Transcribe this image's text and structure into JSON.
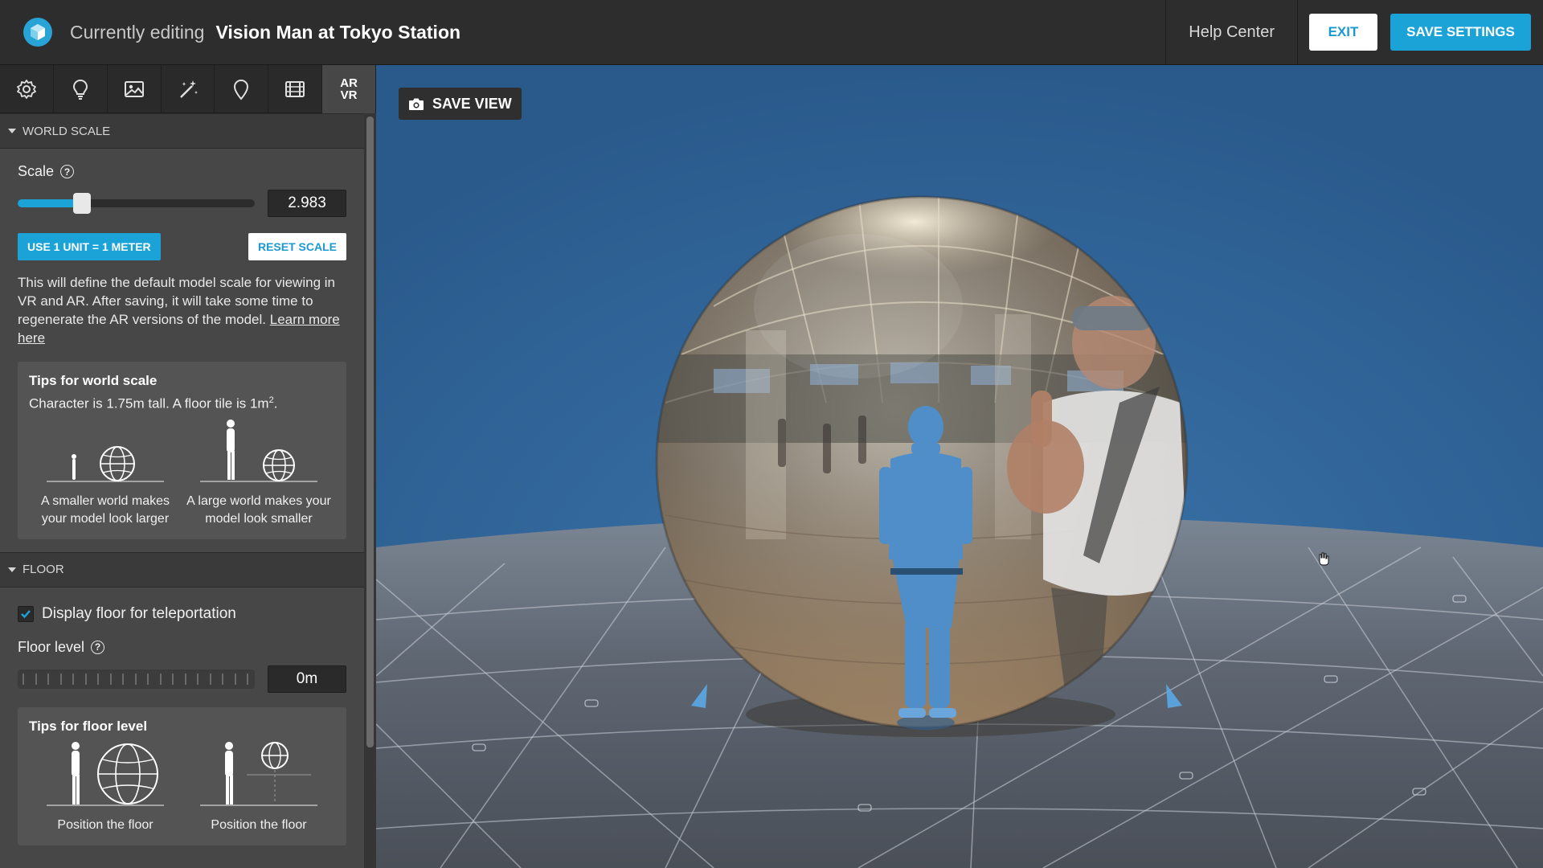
{
  "header": {
    "prefix": "Currently editing",
    "title": "Vision Man at Tokyo Station",
    "help_label": "Help Center",
    "exit_label": "EXIT",
    "save_label": "SAVE SETTINGS"
  },
  "toolbar": {
    "tools": [
      "settings-icon",
      "lightbulb-icon",
      "image-icon",
      "magic-wand-icon",
      "map-pin-icon",
      "film-icon",
      "ar-vr-icon"
    ],
    "ar_vr_label_top": "AR",
    "ar_vr_label_bottom": "VR",
    "active": "ar-vr"
  },
  "world_scale": {
    "section_title": "WORLD SCALE",
    "scale_label": "Scale",
    "scale_value": "2.983",
    "slider_fraction": 0.27,
    "unit_button": "USE 1 UNIT = 1 METER",
    "reset_button": "RESET SCALE",
    "description": "This will define the default model scale for viewing in VR and AR. After saving, it will take some time to regenerate the AR versions of the model.",
    "learn_more": "Learn more here",
    "tips_title": "Tips for world scale",
    "tips_sub_prefix": "Character is 1.75m tall. A floor tile is 1m",
    "tips_sub_sup": "2",
    "tips_sub_suffix": ".",
    "tip_small": "A smaller world makes your model look larger",
    "tip_large": "A large world makes your model look smaller"
  },
  "floor": {
    "section_title": "FLOOR",
    "display_label": "Display floor for teleportation",
    "display_checked": true,
    "level_label": "Floor level",
    "level_value": "0m",
    "tips_title": "Tips for floor level",
    "tip_left": "Position the floor",
    "tip_right": "Position the floor"
  },
  "viewport": {
    "save_view_label": "SAVE VIEW"
  },
  "colors": {
    "accent": "#1ba3d8",
    "sky": "#2f6498",
    "panel": "#474747"
  }
}
